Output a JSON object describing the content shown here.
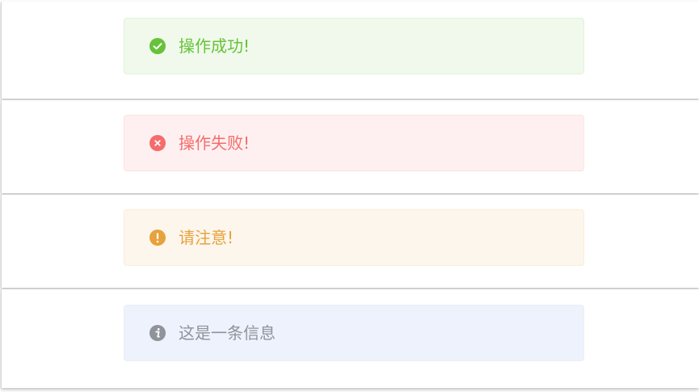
{
  "messages": [
    {
      "type": "success",
      "icon": "check-circle-icon",
      "text": "操作成功!",
      "color": "#67c23a"
    },
    {
      "type": "error",
      "icon": "close-circle-icon",
      "text": "操作失败!",
      "color": "#f56c6c"
    },
    {
      "type": "warning",
      "icon": "warning-circle-icon",
      "text": "请注意!",
      "color": "#e6a23c"
    },
    {
      "type": "info",
      "icon": "info-circle-icon",
      "text": "这是一条信息",
      "color": "#909399"
    }
  ]
}
